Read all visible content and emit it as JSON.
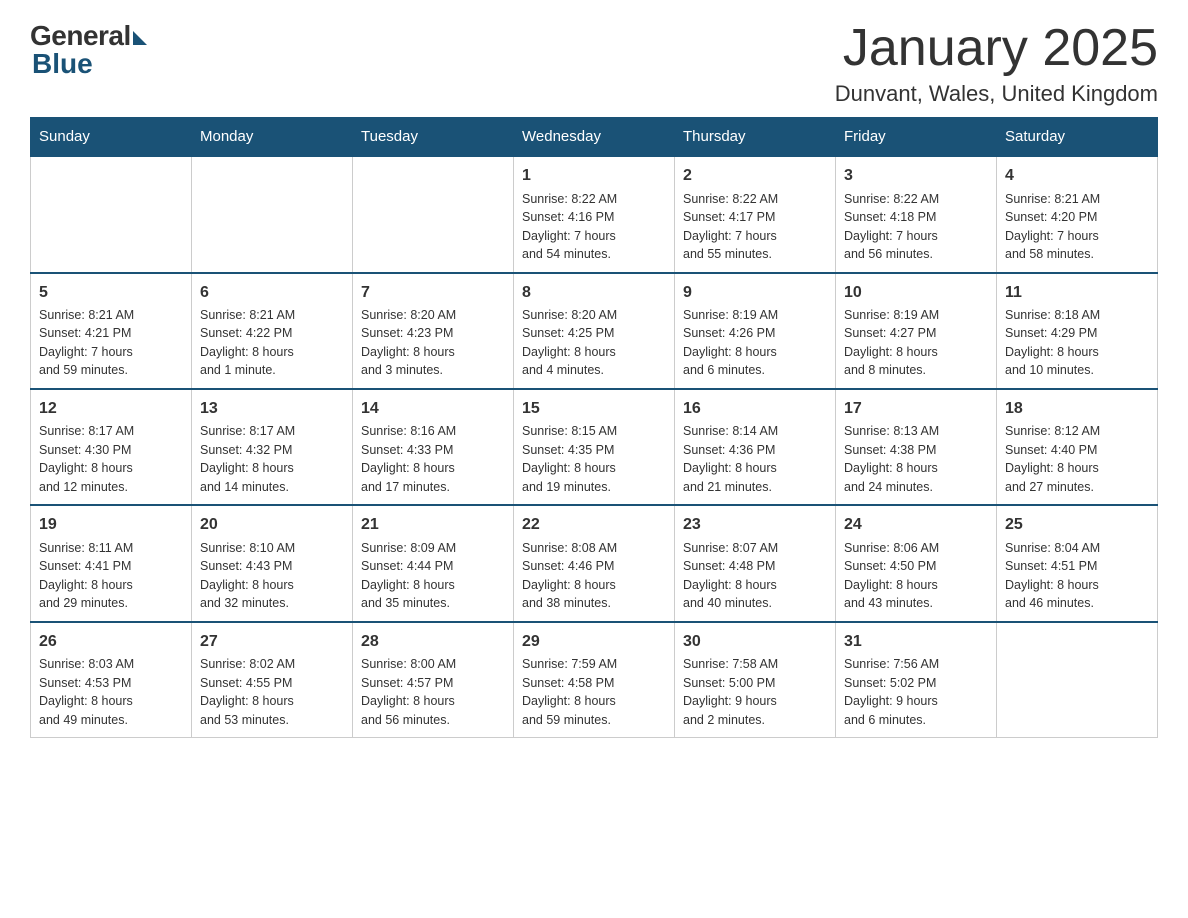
{
  "logo": {
    "general": "General",
    "blue": "Blue"
  },
  "title": "January 2025",
  "location": "Dunvant, Wales, United Kingdom",
  "days_of_week": [
    "Sunday",
    "Monday",
    "Tuesday",
    "Wednesday",
    "Thursday",
    "Friday",
    "Saturday"
  ],
  "weeks": [
    [
      {
        "day": "",
        "info": ""
      },
      {
        "day": "",
        "info": ""
      },
      {
        "day": "",
        "info": ""
      },
      {
        "day": "1",
        "info": "Sunrise: 8:22 AM\nSunset: 4:16 PM\nDaylight: 7 hours\nand 54 minutes."
      },
      {
        "day": "2",
        "info": "Sunrise: 8:22 AM\nSunset: 4:17 PM\nDaylight: 7 hours\nand 55 minutes."
      },
      {
        "day": "3",
        "info": "Sunrise: 8:22 AM\nSunset: 4:18 PM\nDaylight: 7 hours\nand 56 minutes."
      },
      {
        "day": "4",
        "info": "Sunrise: 8:21 AM\nSunset: 4:20 PM\nDaylight: 7 hours\nand 58 minutes."
      }
    ],
    [
      {
        "day": "5",
        "info": "Sunrise: 8:21 AM\nSunset: 4:21 PM\nDaylight: 7 hours\nand 59 minutes."
      },
      {
        "day": "6",
        "info": "Sunrise: 8:21 AM\nSunset: 4:22 PM\nDaylight: 8 hours\nand 1 minute."
      },
      {
        "day": "7",
        "info": "Sunrise: 8:20 AM\nSunset: 4:23 PM\nDaylight: 8 hours\nand 3 minutes."
      },
      {
        "day": "8",
        "info": "Sunrise: 8:20 AM\nSunset: 4:25 PM\nDaylight: 8 hours\nand 4 minutes."
      },
      {
        "day": "9",
        "info": "Sunrise: 8:19 AM\nSunset: 4:26 PM\nDaylight: 8 hours\nand 6 minutes."
      },
      {
        "day": "10",
        "info": "Sunrise: 8:19 AM\nSunset: 4:27 PM\nDaylight: 8 hours\nand 8 minutes."
      },
      {
        "day": "11",
        "info": "Sunrise: 8:18 AM\nSunset: 4:29 PM\nDaylight: 8 hours\nand 10 minutes."
      }
    ],
    [
      {
        "day": "12",
        "info": "Sunrise: 8:17 AM\nSunset: 4:30 PM\nDaylight: 8 hours\nand 12 minutes."
      },
      {
        "day": "13",
        "info": "Sunrise: 8:17 AM\nSunset: 4:32 PM\nDaylight: 8 hours\nand 14 minutes."
      },
      {
        "day": "14",
        "info": "Sunrise: 8:16 AM\nSunset: 4:33 PM\nDaylight: 8 hours\nand 17 minutes."
      },
      {
        "day": "15",
        "info": "Sunrise: 8:15 AM\nSunset: 4:35 PM\nDaylight: 8 hours\nand 19 minutes."
      },
      {
        "day": "16",
        "info": "Sunrise: 8:14 AM\nSunset: 4:36 PM\nDaylight: 8 hours\nand 21 minutes."
      },
      {
        "day": "17",
        "info": "Sunrise: 8:13 AM\nSunset: 4:38 PM\nDaylight: 8 hours\nand 24 minutes."
      },
      {
        "day": "18",
        "info": "Sunrise: 8:12 AM\nSunset: 4:40 PM\nDaylight: 8 hours\nand 27 minutes."
      }
    ],
    [
      {
        "day": "19",
        "info": "Sunrise: 8:11 AM\nSunset: 4:41 PM\nDaylight: 8 hours\nand 29 minutes."
      },
      {
        "day": "20",
        "info": "Sunrise: 8:10 AM\nSunset: 4:43 PM\nDaylight: 8 hours\nand 32 minutes."
      },
      {
        "day": "21",
        "info": "Sunrise: 8:09 AM\nSunset: 4:44 PM\nDaylight: 8 hours\nand 35 minutes."
      },
      {
        "day": "22",
        "info": "Sunrise: 8:08 AM\nSunset: 4:46 PM\nDaylight: 8 hours\nand 38 minutes."
      },
      {
        "day": "23",
        "info": "Sunrise: 8:07 AM\nSunset: 4:48 PM\nDaylight: 8 hours\nand 40 minutes."
      },
      {
        "day": "24",
        "info": "Sunrise: 8:06 AM\nSunset: 4:50 PM\nDaylight: 8 hours\nand 43 minutes."
      },
      {
        "day": "25",
        "info": "Sunrise: 8:04 AM\nSunset: 4:51 PM\nDaylight: 8 hours\nand 46 minutes."
      }
    ],
    [
      {
        "day": "26",
        "info": "Sunrise: 8:03 AM\nSunset: 4:53 PM\nDaylight: 8 hours\nand 49 minutes."
      },
      {
        "day": "27",
        "info": "Sunrise: 8:02 AM\nSunset: 4:55 PM\nDaylight: 8 hours\nand 53 minutes."
      },
      {
        "day": "28",
        "info": "Sunrise: 8:00 AM\nSunset: 4:57 PM\nDaylight: 8 hours\nand 56 minutes."
      },
      {
        "day": "29",
        "info": "Sunrise: 7:59 AM\nSunset: 4:58 PM\nDaylight: 8 hours\nand 59 minutes."
      },
      {
        "day": "30",
        "info": "Sunrise: 7:58 AM\nSunset: 5:00 PM\nDaylight: 9 hours\nand 2 minutes."
      },
      {
        "day": "31",
        "info": "Sunrise: 7:56 AM\nSunset: 5:02 PM\nDaylight: 9 hours\nand 6 minutes."
      },
      {
        "day": "",
        "info": ""
      }
    ]
  ]
}
